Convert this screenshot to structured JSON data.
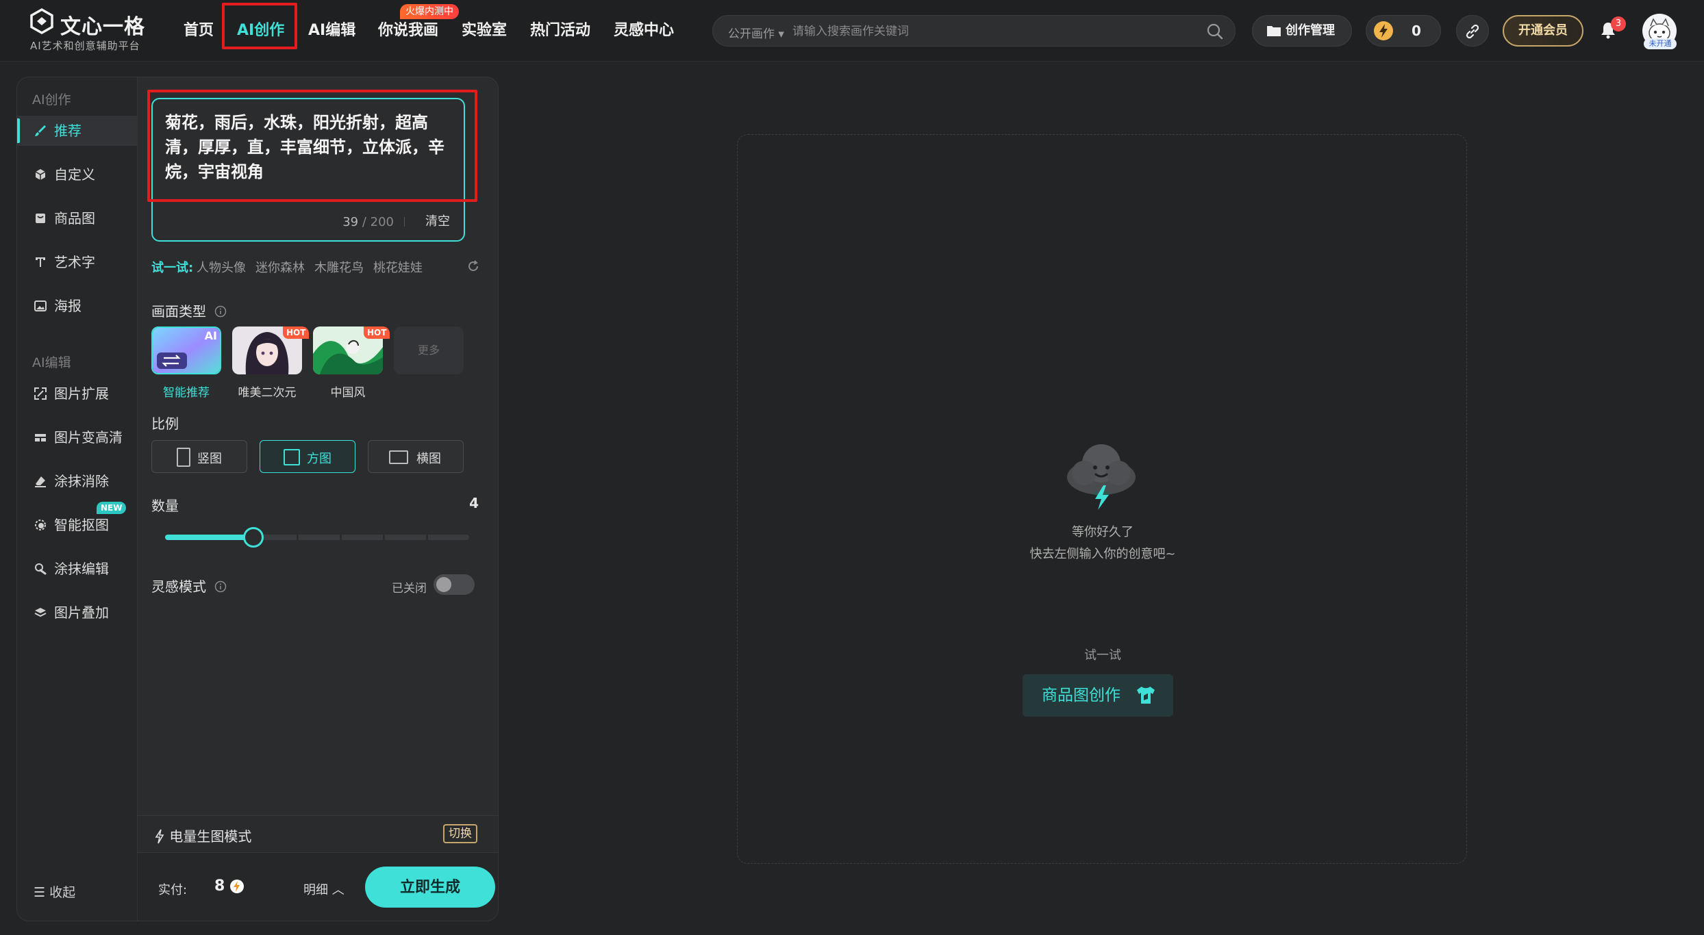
{
  "brand": {
    "name": "文心一格",
    "slogan": "AI艺术和创意辅助平台"
  },
  "nav": {
    "items": [
      "首页",
      "AI创作",
      "AI编辑",
      "你说我画",
      "实验室",
      "热门活动",
      "灵感中心"
    ],
    "active": "AI创作",
    "hot_tag": "火爆内测中"
  },
  "search": {
    "scope": "公开画作",
    "placeholder": "请输入搜索画作关键词"
  },
  "header": {
    "manage_label": "创作管理",
    "energy_count": "0",
    "member_label": "开通会员",
    "notification_count": "3",
    "avatar_tag": "未开通"
  },
  "sidebar": {
    "section_create": "AI创作",
    "create_items": [
      "推荐",
      "自定义",
      "商品图",
      "艺术字",
      "海报"
    ],
    "active_item": "推荐",
    "section_edit": "AI编辑",
    "edit_items": [
      "图片扩展",
      "图片变高清",
      "涂抹消除",
      "智能抠图",
      "涂抹编辑",
      "图片叠加"
    ],
    "new_badge": "NEW",
    "collapse_label": "收起"
  },
  "prompt": {
    "text": "菊花，雨后，水珠，阳光折射，超高清，厚厚，直，丰富细节，立体派，辛烷，宇宙视角",
    "count": "39",
    "max": "/ 200",
    "clear_label": "清空"
  },
  "try_row": {
    "label": "试一试:",
    "chips": [
      "人物头像",
      "迷你森林",
      "木雕花鸟",
      "桃花娃娃"
    ]
  },
  "style_type": {
    "title": "画面类型",
    "options": [
      {
        "name": "智能推荐",
        "badge": "AI",
        "selected": true
      },
      {
        "name": "唯美二次元",
        "badge": "HOT",
        "selected": false
      },
      {
        "name": "中国风",
        "badge": "HOT",
        "selected": false
      }
    ],
    "more_label": "更多"
  },
  "ratio": {
    "title": "比例",
    "options": [
      "竖图",
      "方图",
      "横图"
    ],
    "selected": "方图"
  },
  "quantity": {
    "title": "数量",
    "value": "4",
    "min": 1,
    "max": 8,
    "current": 4
  },
  "inspiration": {
    "title": "灵感模式",
    "status": "已关闭",
    "enabled": false
  },
  "power_mode": {
    "label": "电量生图模式",
    "switch_label": "切换"
  },
  "footer": {
    "pay_label": "实付:",
    "pay_value": "8",
    "detail_label": "明细",
    "generate_label": "立即生成"
  },
  "canvas": {
    "empty_title": "等你好久了",
    "empty_sub": "快去左侧输入你的创意吧~",
    "try_title": "试一试",
    "product_btn": "商品图创作"
  },
  "colors": {
    "accent": "#3ee0d8",
    "background": "#232425",
    "panel": "#2b2c2e",
    "highlight_box": "#e11d1d",
    "gold": "#c6a66a"
  }
}
